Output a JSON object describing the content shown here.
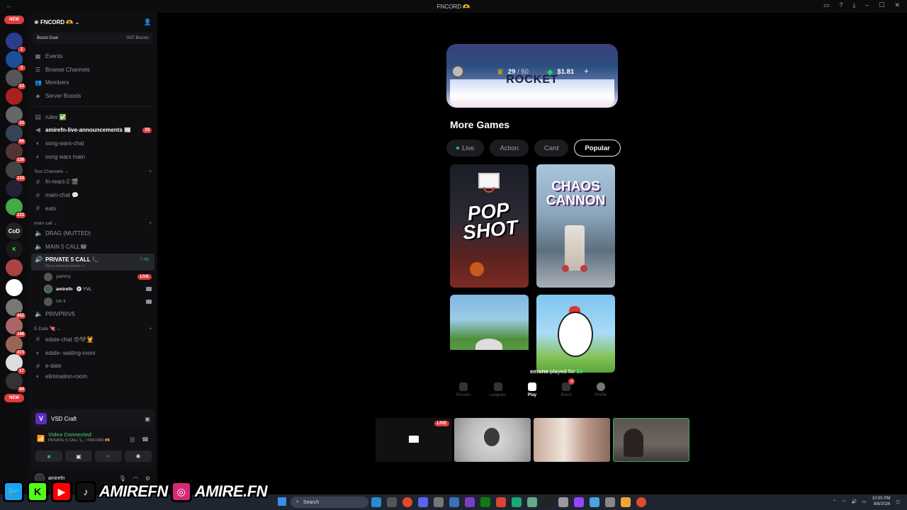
{
  "window": {
    "title": "FNCORD 🫶"
  },
  "rail": {
    "new_label": "NEW",
    "badges": [
      "1",
      "1",
      "2",
      "23",
      "33",
      "96",
      "130",
      "133",
      "223",
      "342",
      "168",
      "473",
      "17",
      "94",
      "1"
    ],
    "cod_label": "CoD"
  },
  "server": {
    "name": "FNCORD 🫶",
    "boost_goal_label": "Boost Goal",
    "boost_goal_count": "0/37 Boosts",
    "nav": [
      {
        "label": "Events",
        "icon": "calendar-icon"
      },
      {
        "label": "Browse Channels",
        "icon": "list-icon"
      },
      {
        "label": "Members",
        "icon": "members-icon"
      },
      {
        "label": "Server Boosts",
        "icon": "boost-icon"
      }
    ],
    "channels_top": [
      {
        "label": "rules ✅",
        "icon": "#"
      },
      {
        "label": "amirefn-live-announcements 📰",
        "icon": "📢",
        "count": "23"
      },
      {
        "label": "song-wars-chat",
        "icon": "🔊"
      },
      {
        "label": "song wars main",
        "icon": "🔊"
      }
    ],
    "text_channels_label": "Text Channels",
    "text_channels": [
      {
        "label": "fn-react-2 🎬"
      },
      {
        "label": "main-chat 💬"
      },
      {
        "label": "eats"
      }
    ],
    "main_call_label": "main call",
    "main_call": [
      {
        "label": "DRAG (MUTTED)"
      },
      {
        "label": "MAIN 5 CALL☎"
      }
    ],
    "active_channel": {
      "label": "PRIVATE 5 CALL 📞",
      "time": "7:46",
      "status": "Set a channel status ✏"
    },
    "voice_users": [
      {
        "name": "yammy",
        "live": "LIVE"
      },
      {
        "name": "amirefn",
        "tag": "💿 YVL"
      },
      {
        "name": "luh k"
      }
    ],
    "after_call": {
      "label": "PRIVPRIV5"
    },
    "edate_label": "E-Date 💘",
    "edate": [
      {
        "label": "edate-chat 😍🖤💆"
      },
      {
        "label": "edate- waiting-room"
      },
      {
        "label": "e-date"
      },
      {
        "label": "elimination-room"
      }
    ]
  },
  "activity": {
    "label": "VSD Craft",
    "logo": "V"
  },
  "voice_panel": {
    "title": "Video Connected",
    "subtitle": "PRIVATE 5 CALL 📞 / FNCORD 🫶"
  },
  "user": {
    "name": "amirefn"
  },
  "game": {
    "crowns": "29",
    "crowns_max": "/ 50",
    "cash": "$1.81",
    "plus": "+",
    "banner_text": "ROCKET",
    "section_title": "More Games",
    "tabs": [
      "Live",
      "Action",
      "Card",
      "Popular"
    ],
    "active_tab": "Popular",
    "cards": [
      {
        "title": "POP SHOT"
      },
      {
        "title": "CHAOS CANNON"
      },
      {
        "title": ""
      },
      {
        "title": ""
      }
    ],
    "notice_name": "emone",
    "notice_text": "played for",
    "notice_amount": "$8",
    "bottom_nav": [
      {
        "label": "Results"
      },
      {
        "label": "Leagues"
      },
      {
        "label": "Play"
      },
      {
        "label": "Boost",
        "badge": "4"
      },
      {
        "label": "Profile"
      }
    ]
  },
  "streams": {
    "live_label": "LIVE"
  },
  "taskbar": {
    "search_placeholder": "Search",
    "time": "10:55 PM",
    "date": "8/8/2026"
  },
  "social": {
    "handle1": "AMIREFN",
    "handle2": "AMIRE.FN"
  },
  "colors": {
    "accent_green": "#3ba55d",
    "badge_red": "#e03c3c",
    "money_green": "#45d483"
  }
}
